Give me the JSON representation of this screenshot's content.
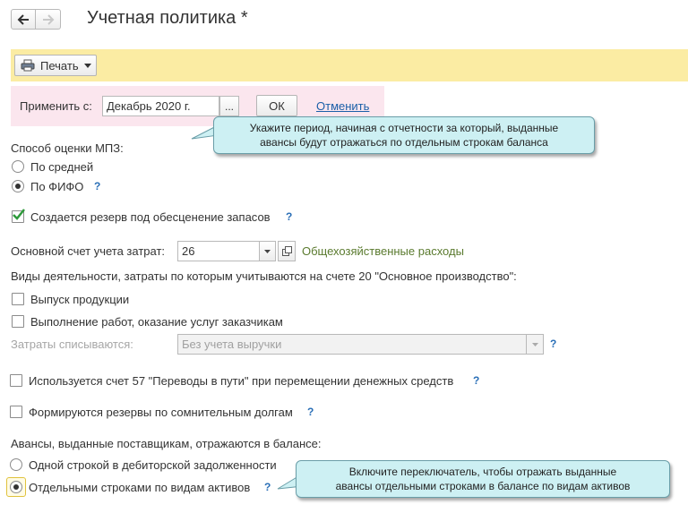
{
  "header": {
    "title": "Учетная политика *"
  },
  "toolbar": {
    "print_label": "Печать"
  },
  "period": {
    "label": "Применить с:",
    "value": "Декабрь 2020 г.",
    "select_btn": "...",
    "ok_label": "ОК",
    "cancel_label": "Отменить"
  },
  "tip_period": {
    "line1": "Укажите период, начиная с отчетности за который, выданные",
    "line2": "авансы будут отражаться по отдельным строкам баланса"
  },
  "mpz": {
    "label": "Способ оценки МПЗ:",
    "opt_avg": "По средней",
    "opt_fifo": "По ФИФО",
    "selected": "По ФИФО"
  },
  "reserve": {
    "label": "Создается резерв под обесценение запасов",
    "checked": true
  },
  "account": {
    "label": "Основной счет учета затрат:",
    "value": "26",
    "description": "Общехозяйственные расходы"
  },
  "activities": {
    "label": "Виды деятельности, затраты по которым учитываются на счете 20 \"Основное производство\":",
    "production": "Выпуск продукции",
    "services": "Выполнение работ, оказание услуг заказчикам"
  },
  "writeoff": {
    "label": "Затраты списываются:",
    "value": "Без учета выручки"
  },
  "account57": {
    "label": "Используется счет 57 \"Переводы в пути\" при перемещении денежных средств"
  },
  "doubtful": {
    "label": "Формируются резервы по сомнительным долгам"
  },
  "advances": {
    "label": "Авансы, выданные поставщикам, отражаются в балансе:",
    "opt_single": "Одной строкой в дебиторской задолженности",
    "opt_separate": "Отдельными строками по видам активов",
    "selected": "Отдельными строками по видам активов"
  },
  "tip_switch": {
    "line1": "Включите переключатель, чтобы отражать выданные",
    "line2": "авансы отдельными строками в балансе по видам активов"
  },
  "help_mark": "?",
  "colors": {
    "toolbar": "#fbeca3",
    "period_bg": "#fbe6ee",
    "tooltip": "#cdf0f3",
    "link": "#1b5fa8",
    "account_desc": "#5a7a2e"
  },
  "icons": [
    "back-arrow-icon",
    "forward-arrow-icon",
    "printer-icon",
    "dropdown-arrow-icon",
    "open-icon",
    "checkmark-icon",
    "help-icon"
  ]
}
